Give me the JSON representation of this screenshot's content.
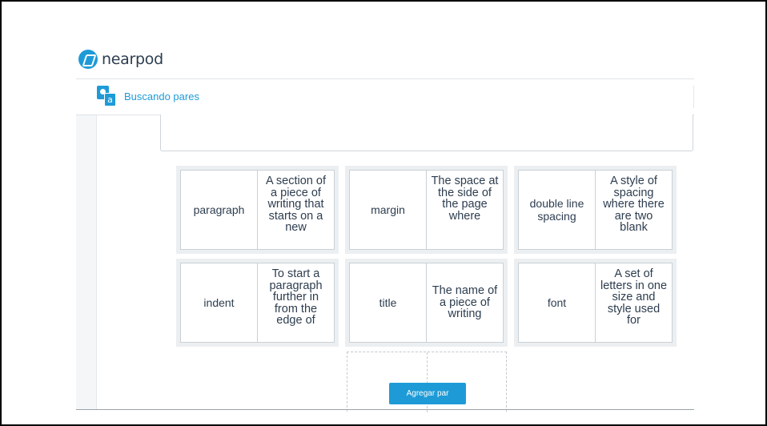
{
  "brand": {
    "name": "nearpod",
    "color": "#1e9bd7"
  },
  "activity": {
    "title": "Buscando pares",
    "icon": "matching-pairs-icon",
    "icon_letter": "a"
  },
  "instructions": {
    "text": ""
  },
  "pairs": [
    {
      "term": "paragraph",
      "definition": "A section of a piece of writing that starts on a new"
    },
    {
      "term": "margin",
      "definition": "The space at the side of the page where"
    },
    {
      "term": "double line spacing",
      "definition": "A style of spacing where there are two blank"
    },
    {
      "term": "indent",
      "definition": "To start a paragraph further in from the edge of"
    },
    {
      "term": "title",
      "definition": "The name of a piece of writing"
    },
    {
      "term": "font",
      "definition": "A set of letters in one size and style used for"
    }
  ],
  "add_pair_label": "Agregar par"
}
